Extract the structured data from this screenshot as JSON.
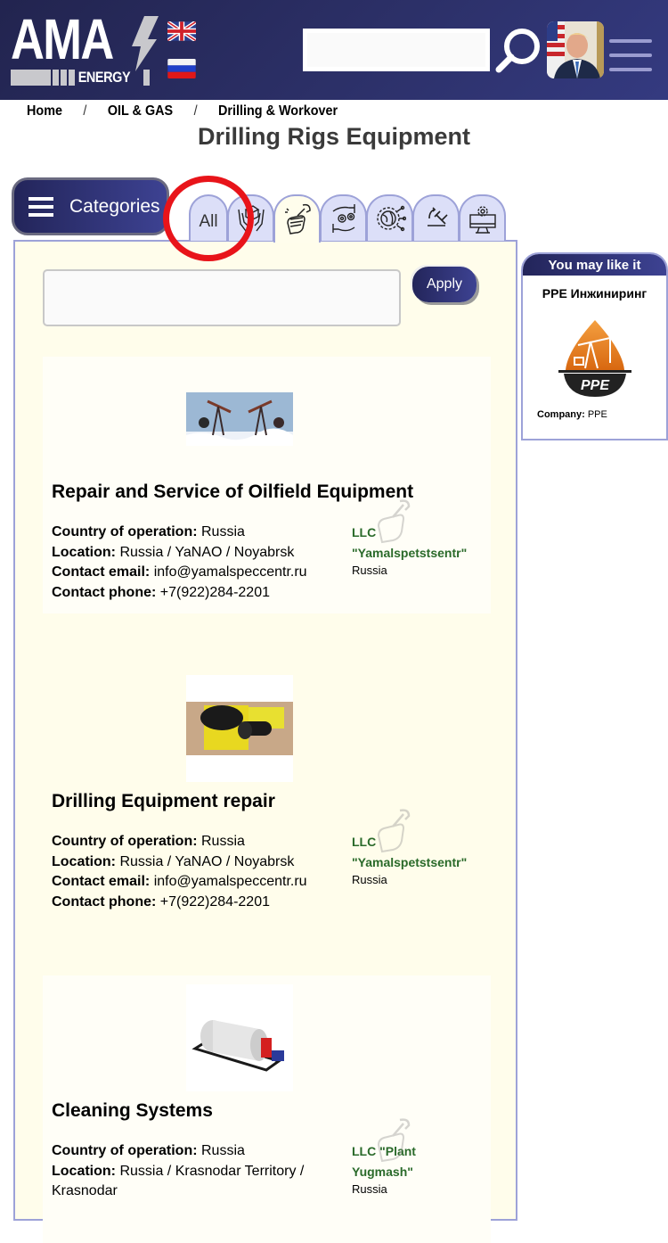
{
  "header": {
    "logo_main": "AMA",
    "logo_sub": "ENERGY",
    "language_flags": [
      "uk-flag-icon",
      "russia-flag-icon"
    ],
    "search_value": "",
    "search_placeholder": "",
    "search_icon": "search-icon",
    "menu_icon": "hamburger-icon"
  },
  "breadcrumb": [
    "Home",
    "OIL & GAS",
    "Drilling & Workover"
  ],
  "breadcrumb_separator": "/",
  "page_title": "Drilling Rigs Equipment",
  "categories_button": {
    "label": "Categories"
  },
  "tabs": [
    {
      "label": "All",
      "icon": null,
      "active": false
    },
    {
      "label": "",
      "icon": "hands-box-icon",
      "active": false
    },
    {
      "label": "",
      "icon": "hand-wrench-icon",
      "active": true
    },
    {
      "label": "",
      "icon": "hands-gears-icon",
      "active": false
    },
    {
      "label": "",
      "icon": "gear-globe-icon",
      "active": false
    },
    {
      "label": "",
      "icon": "hammer-icon",
      "active": false
    },
    {
      "label": "",
      "icon": "monitor-gear-icon",
      "active": false
    }
  ],
  "filter": {
    "value": "",
    "placeholder": "",
    "apply_label": "Apply"
  },
  "listings": [
    {
      "title": "Repair and Service of Oilfield Equipment",
      "image": "oil-pumpjacks-image",
      "fields": [
        {
          "label": "Country of operation:",
          "value": "Russia"
        },
        {
          "label": "Location:",
          "value": "Russia / YaNAO / Noyabrsk"
        },
        {
          "label": "Contact email:",
          "value": "info@yamalspeccentr.ru"
        },
        {
          "label": "Contact phone:",
          "value": "+7(922)284-2201"
        }
      ],
      "company_name_line1": "LLC",
      "company_name_line2": "\"Yamalspetstsentr\"",
      "company_country": "Russia"
    },
    {
      "title": "Drilling Equipment repair",
      "image": "drilling-equipment-image",
      "fields": [
        {
          "label": "Country of operation:",
          "value": "Russia"
        },
        {
          "label": "Location:",
          "value": "Russia / YaNAO / Noyabrsk"
        },
        {
          "label": "Contact email:",
          "value": "info@yamalspeccentr.ru"
        },
        {
          "label": "Contact phone:",
          "value": "+7(922)284-2201"
        }
      ],
      "company_name_line1": "LLC",
      "company_name_line2": "\"Yamalspetstsentr\"",
      "company_country": "Russia"
    },
    {
      "title": "Cleaning Systems",
      "image": "cleaning-system-tank-image",
      "fields": [
        {
          "label": "Country of operation:",
          "value": "Russia"
        },
        {
          "label": "Location:",
          "value": "Russia / Krasnodar Territory / Krasnodar"
        }
      ],
      "company_name_line1": "LLC \"Plant",
      "company_name_line2": "Yugmash\"",
      "company_country": "Russia"
    }
  ],
  "sidebar": {
    "heading": "You may like it",
    "company_title": "PPE Инжиниринг",
    "logo_text": "PPE",
    "company_label": "Company:",
    "company_value": "PPE"
  },
  "colors": {
    "header_bg": "#2a2d64",
    "accent_navy": "#23255a",
    "tab_bg": "#dcdff8",
    "tab_border": "#9da2d8",
    "panel_bg": "#fffdeb",
    "company_link": "#2a6a2a",
    "annotation_red": "#e8141a",
    "ppe_orange": "#e8821e"
  }
}
